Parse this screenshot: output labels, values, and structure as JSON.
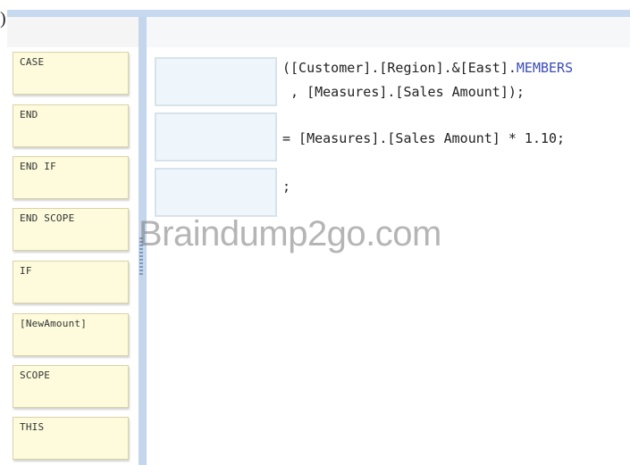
{
  "corner_fragment": ")",
  "tokens": [
    {
      "label": "CASE"
    },
    {
      "label": "END"
    },
    {
      "label": "END IF"
    },
    {
      "label": "END SCOPE"
    },
    {
      "label": "IF"
    },
    {
      "label": "[NewAmount]"
    },
    {
      "label": "SCOPE"
    },
    {
      "label": "THIS"
    }
  ],
  "code": {
    "line1_prefix": "([Customer].[Region].&[East].",
    "line1_keyword": "MEMBERS",
    "line2": " , [Measures].[Sales Amount]);",
    "line3": "= [Measures].[Sales Amount] * 1.10;",
    "line4": ";"
  },
  "colors": {
    "keyword": "#3b4cb8",
    "token_bg": "#fdfbdc",
    "drop_target_bg": "#eef6fb",
    "divider": "#c3d6ec"
  },
  "watermark": "Braindump2go.com"
}
